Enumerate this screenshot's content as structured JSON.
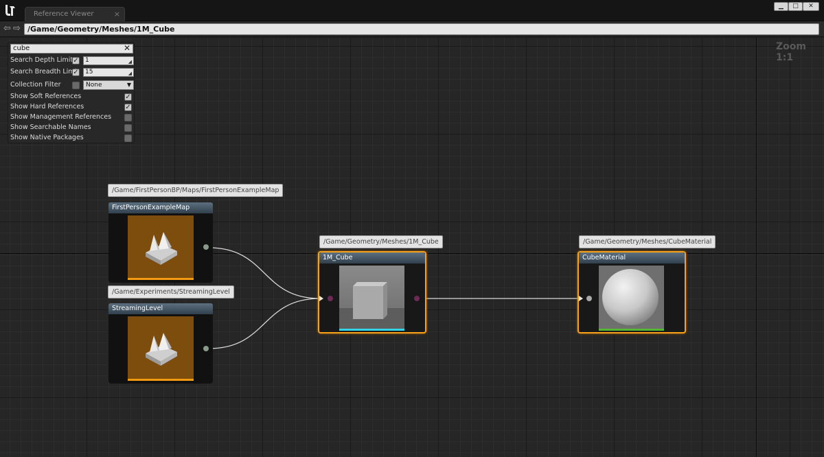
{
  "window": {
    "tab_title": "Reference Viewer",
    "tab_close": "×",
    "minimize": "▁",
    "maximize": "□",
    "close": "✕"
  },
  "pathbar": {
    "back_icon": "arrow-left",
    "forward_icon": "arrow-right",
    "path": "/Game/Geometry/Meshes/1M_Cube"
  },
  "graph": {
    "zoom_label": "Zoom 1:1"
  },
  "filters": {
    "search_value": "cube",
    "search_clear": "✕",
    "search_depth_label": "Search Depth Limit",
    "search_depth_checked": true,
    "search_depth_value": "1",
    "search_breadth_label": "Search Breadth Limit",
    "search_breadth_checked": true,
    "search_breadth_value": "15",
    "collection_label": "Collection Filter",
    "collection_checked": false,
    "collection_value": "None",
    "toggles": [
      {
        "label": "Show Soft References",
        "checked": true
      },
      {
        "label": "Show Hard References",
        "checked": true
      },
      {
        "label": "Show Management References",
        "checked": false
      },
      {
        "label": "Show Searchable Names",
        "checked": false
      },
      {
        "label": "Show Native Packages",
        "checked": false
      }
    ]
  },
  "nodes": {
    "map": {
      "path": "/Game/FirstPersonBP/Maps/FirstPersonExampleMap",
      "title": "FirstPersonExampleMap"
    },
    "streaming": {
      "path": "/Game/Experiments/StreamingLevel",
      "title": "StreamingLevel"
    },
    "cube": {
      "path": "/Game/Geometry/Meshes/1M_Cube",
      "title": "1M_Cube"
    },
    "material": {
      "path": "/Game/Geometry/Meshes/CubeMaterial",
      "title": "CubeMaterial"
    }
  },
  "colors": {
    "selection": "#f7a21a",
    "map_bar": "#f39c12",
    "mesh_bar": "#33d6e8",
    "material_bar": "#55b832"
  }
}
